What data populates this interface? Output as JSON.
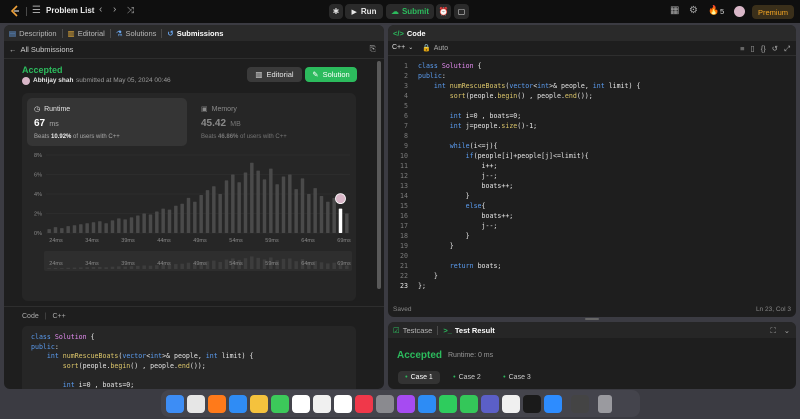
{
  "topbar": {
    "problem_list": "Problem List",
    "run": "Run",
    "submit": "Submit",
    "streak": "5",
    "premium": "Premium"
  },
  "left": {
    "tabs": [
      {
        "label": "Description",
        "icon": "description-icon"
      },
      {
        "label": "Editorial",
        "icon": "book-icon"
      },
      {
        "label": "Solutions",
        "icon": "flask-icon"
      },
      {
        "label": "Submissions",
        "icon": "history-icon"
      }
    ],
    "back_label": "All Submissions",
    "status": "Accepted",
    "user": "Abhijay shah",
    "submitted": "submitted at May 05, 2024 00:46",
    "editorial_btn": "Editorial",
    "solution_btn": "Solution",
    "runtime": {
      "title": "Runtime",
      "value": "67",
      "unit": "ms",
      "beats_prefix": "Beats",
      "beats_value": "10.92%",
      "beats_suffix": "of users with C++"
    },
    "memory": {
      "title": "Memory",
      "value": "45.42",
      "unit": "MB",
      "beats_prefix": "Beats",
      "beats_value": "46.86%",
      "beats_suffix": "of users with C++"
    },
    "code_label": "Code",
    "code_lang": "C++"
  },
  "chart_data": {
    "type": "bar",
    "title": "",
    "xlabel": "",
    "ylabel": "",
    "ylim": [
      0,
      8
    ],
    "y_ticks": [
      "8%",
      "6%",
      "4%",
      "2%",
      "0%"
    ],
    "x_ticks": [
      "24ms",
      "34ms",
      "39ms",
      "44ms",
      "49ms",
      "54ms",
      "59ms",
      "64ms",
      "69ms"
    ],
    "values": [
      0.4,
      0.6,
      0.5,
      0.7,
      0.8,
      0.9,
      1.0,
      1.1,
      1.2,
      1.0,
      1.3,
      1.5,
      1.4,
      1.6,
      1.8,
      2.0,
      1.9,
      2.2,
      2.5,
      2.4,
      2.8,
      3.0,
      3.6,
      3.2,
      3.9,
      4.4,
      4.8,
      4.0,
      5.4,
      6.0,
      5.2,
      6.2,
      7.2,
      6.4,
      5.5,
      6.6,
      5.0,
      5.8,
      6.0,
      4.5,
      5.6,
      4.0,
      4.6,
      3.8,
      3.2,
      3.6,
      2.5,
      2.0
    ],
    "highlight_index": 46
  },
  "editor": {
    "title": "Code",
    "language": "C++",
    "mode": "Auto",
    "saved": "Saved",
    "cursor": "Ln 23, Col 3",
    "lines": [
      "class Solution {",
      "public:",
      "    int numRescueBoats(vector<int>& people, int limit) {",
      "        sort(people.begin() , people.end());",
      "",
      "        int i=0 , boats=0;",
      "        int j=people.size()-1;",
      "",
      "        while(i<=j){",
      "            if(people[i]+people[j]<=limit){",
      "                i++;",
      "                j--;",
      "                boats++;",
      "            }",
      "            else{",
      "                boats++;",
      "                j--;",
      "            }",
      "        }",
      "",
      "        return boats;",
      "    }",
      "};"
    ]
  },
  "left_code_lines": [
    "class Solution {",
    "public:",
    "    int numRescueBoats(vector<int>& people, int limit) {",
    "        sort(people.begin() , people.end());",
    "",
    "        int i=0 , boats=0;",
    "        int j=people.size()-1;"
  ],
  "bottom": {
    "tab_testcase": "Testcase",
    "tab_result": "Test Result",
    "status": "Accepted",
    "runtime": "Runtime: 0 ms",
    "cases": [
      "Case 1",
      "Case 2",
      "Case 3"
    ]
  },
  "dock_apps": [
    {
      "name": "finder",
      "color": "#3d8df5"
    },
    {
      "name": "chrome",
      "color": "#e6e6e6"
    },
    {
      "name": "firefox",
      "color": "#ff7a1a"
    },
    {
      "name": "mail",
      "color": "#2f8cf5"
    },
    {
      "name": "photos",
      "color": "#f5c23d"
    },
    {
      "name": "facetime",
      "color": "#3cc95a"
    },
    {
      "name": "calendar",
      "color": "#ffffff"
    },
    {
      "name": "clock",
      "color": "#f0f0f0"
    },
    {
      "name": "reminders",
      "color": "#ffffff"
    },
    {
      "name": "news",
      "color": "#f0384a"
    },
    {
      "name": "settings",
      "color": "#8a8a8f"
    },
    {
      "name": "podcasts",
      "color": "#a64bf2"
    },
    {
      "name": "appstore",
      "color": "#2d8cf5"
    },
    {
      "name": "whatsapp",
      "color": "#2ecc5d"
    },
    {
      "name": "messages",
      "color": "#34c759"
    },
    {
      "name": "teams",
      "color": "#5b5fc7"
    },
    {
      "name": "discord",
      "color": "#f0f0f0"
    },
    {
      "name": "terminal",
      "color": "#1a1a1a"
    },
    {
      "name": "zoom",
      "color": "#2d8cff"
    },
    {
      "name": "window",
      "color": "#444"
    },
    {
      "name": "trash",
      "color": "#9a9a9f"
    }
  ]
}
